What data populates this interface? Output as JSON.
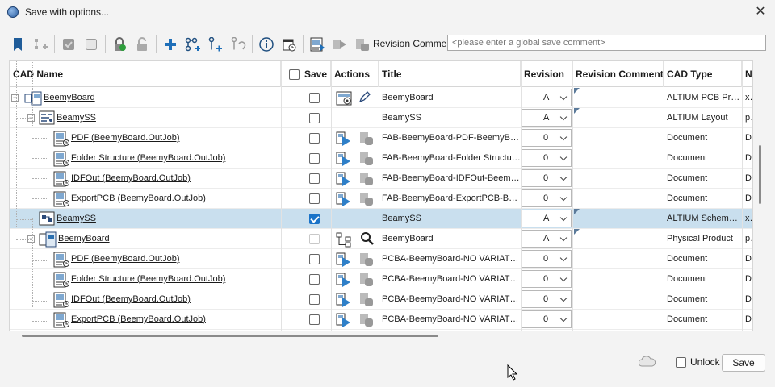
{
  "window": {
    "title": "Save with options...",
    "close_glyph": "✕"
  },
  "toolbar": {
    "icons": [
      "bookmark-icon",
      "hierarchy-add-icon",
      "checkbox-checked-icon",
      "checkbox-empty-icon",
      "lock-icon",
      "unlock-icon",
      "add-icon",
      "tree-add-icon",
      "node-add-icon",
      "undo-branch-icon",
      "info-icon",
      "calendar-icon",
      "outjob-icon",
      "play-icon",
      "document-stack-icon"
    ],
    "revision_label": "Revision Comment",
    "revision_placeholder": "<please enter a global save comment>"
  },
  "table": {
    "headers": {
      "cad_name": "CAD Name",
      "save": "Save",
      "actions": "Actions",
      "title": "Title",
      "revision": "Revision",
      "revision_comment": "Revision Comment",
      "cad_type": "CAD Type",
      "next": "Na"
    },
    "rows": [
      {
        "name": "BeemyBoard",
        "title": "BeemyBoard",
        "revision": "A",
        "cad_type": "ALTIUM PCB Project",
        "extra": "xca",
        "checked": false
      },
      {
        "name": "BeamySS",
        "title": "BeamySS",
        "revision": "A",
        "cad_type": "ALTIUM Layout",
        "extra": "pro",
        "checked": false
      },
      {
        "name": "PDF (BeemyBoard.OutJob)",
        "title": "FAB-BeemyBoard-PDF-BeemyBoard",
        "revision": "0",
        "cad_type": "Document",
        "extra": "DC",
        "checked": false
      },
      {
        "name": "Folder Structure (BeemyBoard.OutJob)",
        "title": "FAB-BeemyBoard-Folder Structure...",
        "revision": "0",
        "cad_type": "Document",
        "extra": "DC",
        "checked": false
      },
      {
        "name": "IDFOut (BeemyBoard.OutJob)",
        "title": "FAB-BeemyBoard-IDFOut-BeemyB...",
        "revision": "0",
        "cad_type": "Document",
        "extra": "DC",
        "checked": false
      },
      {
        "name": "ExportPCB (BeemyBoard.OutJob)",
        "title": "FAB-BeemyBoard-ExportPCB-Bee...",
        "revision": "0",
        "cad_type": "Document",
        "extra": "DC",
        "checked": false
      },
      {
        "name": "BeamySS",
        "title": "BeamySS",
        "revision": "A",
        "cad_type": "ALTIUM Schematic",
        "extra": "xca",
        "checked": true
      },
      {
        "name": "BeemyBoard",
        "title": "BeemyBoard",
        "revision": "A",
        "cad_type": "Physical Product",
        "extra": "pro",
        "checked": false
      },
      {
        "name": "PDF (BeemyBoard.OutJob)",
        "title": "PCBA-BeemyBoard-NO VARIATIO...",
        "revision": "0",
        "cad_type": "Document",
        "extra": "DC",
        "checked": false
      },
      {
        "name": "Folder Structure (BeemyBoard.OutJob)",
        "title": "PCBA-BeemyBoard-NO VARIATIO...",
        "revision": "0",
        "cad_type": "Document",
        "extra": "DC",
        "checked": false
      },
      {
        "name": "IDFOut (BeemyBoard.OutJob)",
        "title": "PCBA-BeemyBoard-NO VARIATIO...",
        "revision": "0",
        "cad_type": "Document",
        "extra": "DC",
        "checked": false
      },
      {
        "name": "ExportPCB (BeemyBoard.OutJob)",
        "title": "PCBA-BeemyBoard-NO VARIATIO...",
        "revision": "0",
        "cad_type": "Document",
        "extra": "DC",
        "checked": false
      }
    ]
  },
  "footer": {
    "unlock_label": "Unlock",
    "save_label": "Save"
  },
  "colors": {
    "selection": "#c9dfee",
    "accent": "#1a73c8"
  }
}
